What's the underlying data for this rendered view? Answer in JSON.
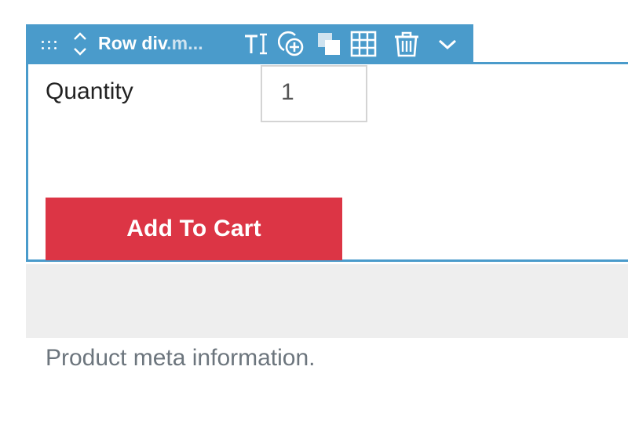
{
  "toolbar": {
    "title_main": "Row div",
    "title_dim": ".m...",
    "icons": [
      "drag-handle-icon",
      "move-up-down-icon",
      "text-cursor-icon",
      "add-circle-icon",
      "duplicate-icon",
      "grid-icon",
      "trash-icon",
      "chevron-down-icon"
    ]
  },
  "form": {
    "quantity_label": "Quantity",
    "quantity_value": "1",
    "add_to_cart_label": "Add To Cart"
  },
  "meta": {
    "text": "Product meta information."
  },
  "colors": {
    "toolbar_bg": "#4a9bcb",
    "cart_button_bg": "#dc3545",
    "band_bg": "#eeeeee"
  }
}
